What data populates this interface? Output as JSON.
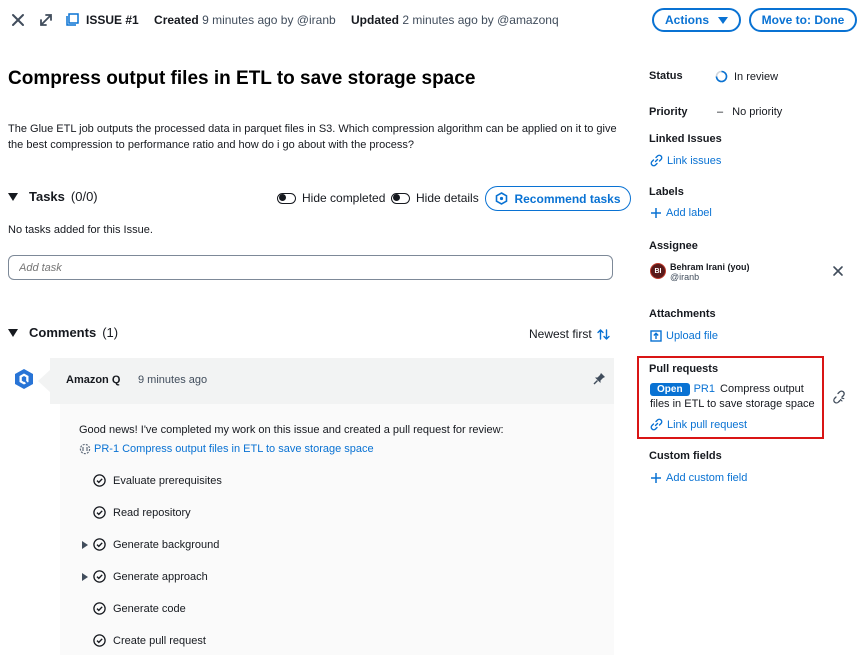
{
  "header": {
    "issue_label": "ISSUE #1",
    "created_label": "Created",
    "created_value": "9 minutes ago by @iranb",
    "updated_label": "Updated",
    "updated_value": "2 minutes ago by @amazonq",
    "actions_button": "Actions",
    "move_button": "Move to: Done"
  },
  "issue": {
    "title": "Compress output files in ETL to save storage space",
    "description": "The Glue ETL job outputs the processed data in parquet files in S3. Which compression algorithm can be applied on it to give the best compression to performance ratio and how do i go about with the process?"
  },
  "tasks": {
    "heading": "Tasks",
    "count": "(0/0)",
    "hide_completed": "Hide completed",
    "hide_details": "Hide details",
    "recommend_button": "Recommend tasks",
    "empty_text": "No tasks added for this Issue.",
    "add_placeholder": "Add task"
  },
  "comments": {
    "heading": "Comments",
    "count": "(1)",
    "sort_label": "Newest first",
    "items": [
      {
        "author": "Amazon Q",
        "time": "9 minutes ago",
        "text": "Good news! I've completed my work on this issue and created a pull request for review:",
        "pr_link": "PR-1 Compress output files in ETL to save storage space",
        "steps": [
          {
            "label": "Evaluate prerequisites",
            "expandable": false
          },
          {
            "label": "Read repository",
            "expandable": false
          },
          {
            "label": "Generate background",
            "expandable": true
          },
          {
            "label": "Generate approach",
            "expandable": true
          },
          {
            "label": "Generate code",
            "expandable": false
          },
          {
            "label": "Create pull request",
            "expandable": false
          }
        ]
      }
    ]
  },
  "sidebar": {
    "status_label": "Status",
    "status_value": "In review",
    "priority_label": "Priority",
    "priority_dash": "–",
    "priority_value": "No priority",
    "linked_label": "Linked Issues",
    "linked_action": "Link issues",
    "labels_label": "Labels",
    "labels_action": "Add label",
    "assignee_label": "Assignee",
    "assignee_initials": "BI",
    "assignee_name": "Behram Irani (you)",
    "assignee_handle": "@iranb",
    "attachments_label": "Attachments",
    "attachments_action": "Upload file",
    "pr_label": "Pull requests",
    "pr_badge": "Open",
    "pr_id": "PR1",
    "pr_title": "Compress output files in ETL to save storage space",
    "pr_action": "Link pull request",
    "custom_label": "Custom fields",
    "custom_action": "Add custom field"
  },
  "colors": {
    "accent": "#0972d3",
    "highlight_border": "#d91515",
    "text": "#16191f"
  }
}
